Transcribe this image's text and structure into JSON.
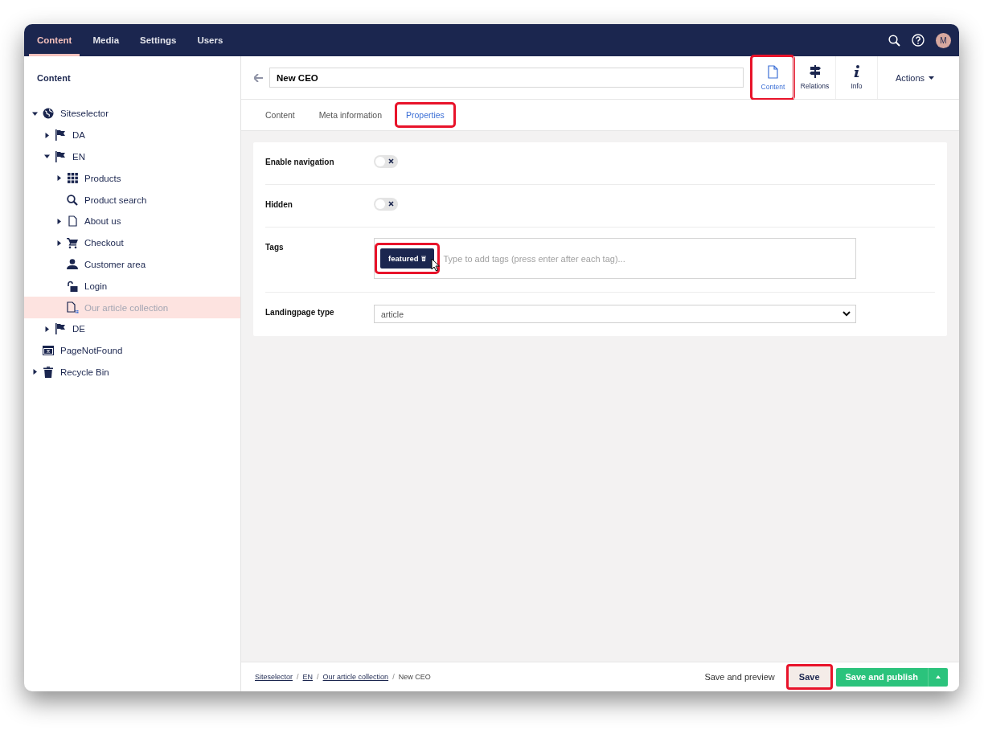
{
  "top_nav": {
    "items": [
      {
        "label": "Content",
        "selected": true
      },
      {
        "label": "Media",
        "selected": false
      },
      {
        "label": "Settings",
        "selected": false
      },
      {
        "label": "Users",
        "selected": false
      }
    ],
    "avatar": "M"
  },
  "sidebar": {
    "title": "Content",
    "tree": [
      {
        "label": "Siteselector",
        "kind": "globe",
        "expanded": true,
        "selected": false,
        "unpublished": false,
        "children": [
          {
            "label": "DA",
            "kind": "flag",
            "expanded": false,
            "selected": false,
            "unpublished": false
          },
          {
            "label": "EN",
            "kind": "flag",
            "expanded": true,
            "selected": false,
            "unpublished": false,
            "children": [
              {
                "label": "Products",
                "kind": "grid",
                "expanded": false,
                "selected": false,
                "unpublished": false
              },
              {
                "label": "Product search",
                "kind": "search",
                "selected": false,
                "unpublished": false
              },
              {
                "label": "About us",
                "kind": "page",
                "expanded": false,
                "selected": false,
                "unpublished": false
              },
              {
                "label": "Checkout",
                "kind": "cart",
                "expanded": false,
                "selected": false,
                "unpublished": false
              },
              {
                "label": "Customer area",
                "kind": "user",
                "selected": false,
                "unpublished": false
              },
              {
                "label": "Login",
                "kind": "unlock",
                "selected": false,
                "unpublished": false
              },
              {
                "label": "Our article collection",
                "kind": "collection",
                "selected": true,
                "unpublished": true
              }
            ]
          },
          {
            "label": "DE",
            "kind": "flag",
            "expanded": false,
            "selected": false,
            "unpublished": false
          }
        ]
      },
      {
        "label": "PageNotFound",
        "kind": "notfound",
        "selected": false,
        "unpublished": false
      },
      {
        "label": "Recycle Bin",
        "kind": "trash",
        "expanded": false,
        "selected": false,
        "unpublished": false
      }
    ]
  },
  "editor": {
    "name": "New CEO",
    "apps": [
      {
        "label": "Content",
        "kind": "page",
        "selected": true,
        "highlighted": true
      },
      {
        "label": "Relations",
        "kind": "signpost",
        "selected": false,
        "highlighted": false
      },
      {
        "label": "Info",
        "kind": "info",
        "selected": false,
        "highlighted": false
      }
    ],
    "actions": "Actions",
    "tabs": [
      {
        "label": "Content",
        "selected": false,
        "highlighted": false
      },
      {
        "label": "Meta information",
        "selected": false,
        "highlighted": false
      },
      {
        "label": "Properties",
        "selected": true,
        "highlighted": true
      }
    ],
    "properties": [
      {
        "kind": "toggle",
        "label": "Enable navigation",
        "on": false
      },
      {
        "kind": "toggle",
        "label": "Hidden",
        "on": false
      },
      {
        "kind": "tags",
        "label": "Tags",
        "tags": [
          "featured"
        ],
        "placeholder": "Type to add tags (press enter after each tag)...",
        "highlighted": true
      },
      {
        "kind": "select",
        "label": "Landingpage type",
        "value": "article"
      }
    ]
  },
  "footer": {
    "breadcrumb": [
      {
        "label": "Siteselector",
        "link": true
      },
      {
        "label": "EN",
        "link": true
      },
      {
        "label": "Our article collection",
        "link": true
      },
      {
        "label": "New CEO",
        "link": false
      }
    ],
    "separator": "/",
    "buttons": [
      {
        "label": "Save and preview",
        "kind": "link",
        "highlighted": false
      },
      {
        "label": "Save",
        "kind": "secondary",
        "highlighted": true
      },
      {
        "label": "Save and publish",
        "kind": "primary",
        "highlighted": false
      }
    ]
  }
}
